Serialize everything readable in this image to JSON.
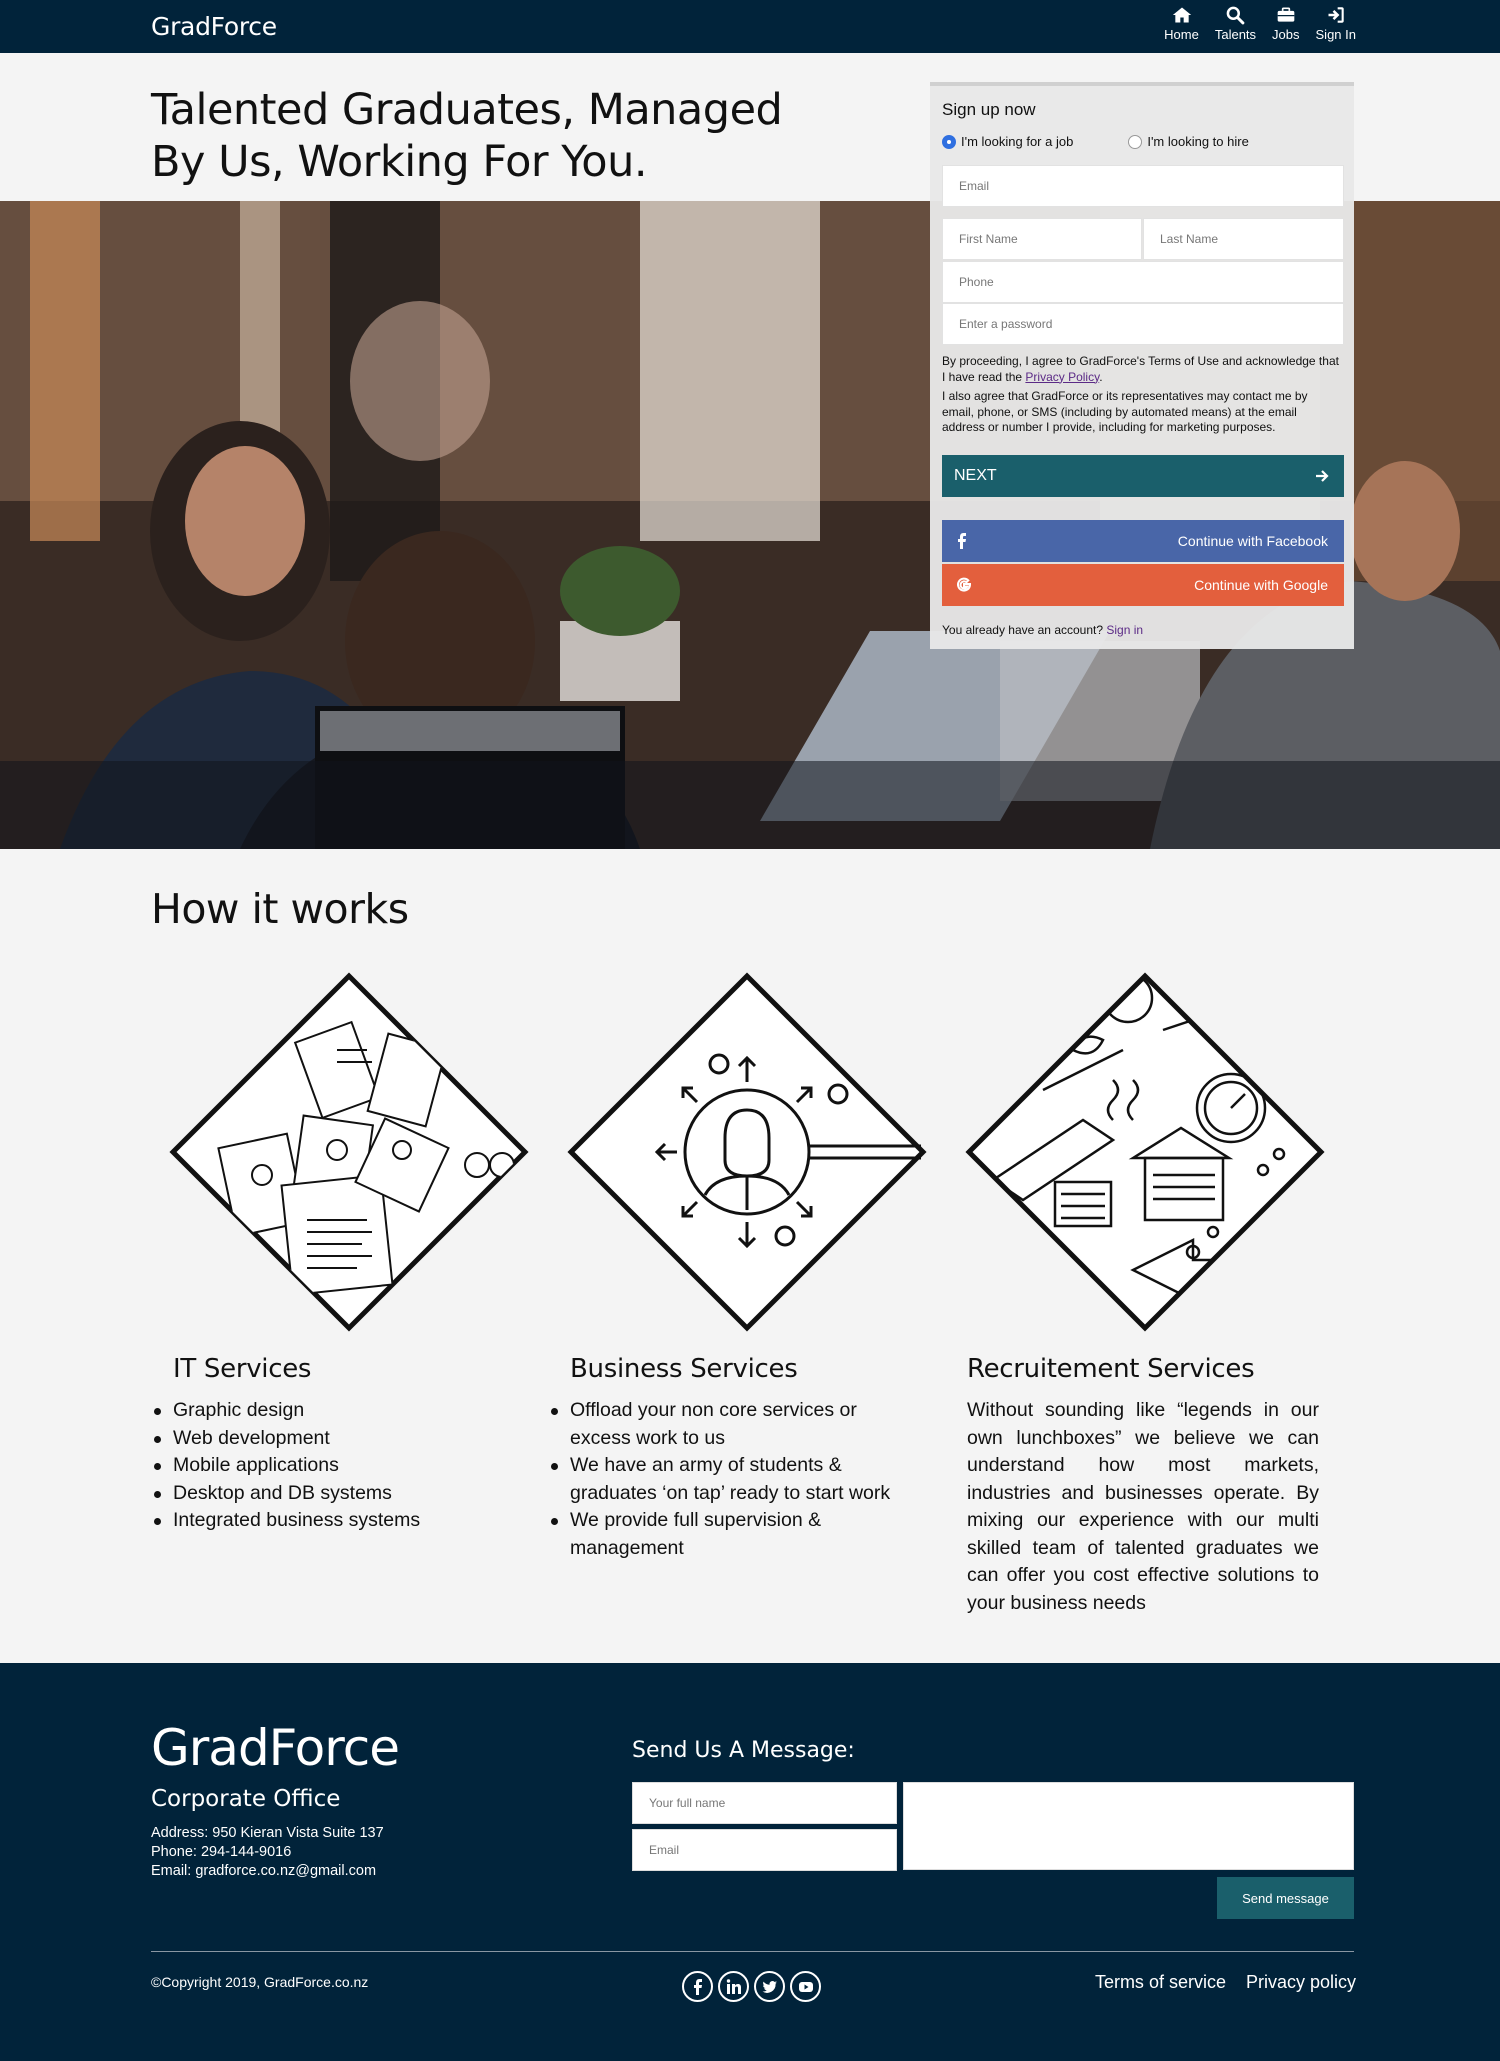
{
  "nav": {
    "brand": "GradForce",
    "items": [
      {
        "label": "Home",
        "icon": "home-icon"
      },
      {
        "label": "Talents",
        "icon": "search-icon"
      },
      {
        "label": "Jobs",
        "icon": "briefcase-icon"
      },
      {
        "label": "Sign In",
        "icon": "sign-in-icon"
      }
    ]
  },
  "hero": {
    "title": "Talented Graduates, Managed By Us, Working For You."
  },
  "signup": {
    "title": "Sign up now",
    "role_options": [
      {
        "label": "I'm looking for a job",
        "selected": true
      },
      {
        "label": "I'm looking to hire",
        "selected": false
      }
    ],
    "email_placeholder": "Email",
    "first_name_placeholder": "First Name",
    "last_name_placeholder": "Last Name",
    "phone_placeholder": "Phone",
    "password_placeholder": "Enter a password",
    "legal_1_prefix": "By proceeding, I agree to GradForce's Terms of Use and acknowledge that I have read the",
    "legal_1_link": "Privacy Policy",
    "legal_1_suffix": ".",
    "legal_2": "I also agree that GradForce or its representatives may contact me by email, phone, or SMS (including by automated means) at the email address or number I provide, including for marketing purposes.",
    "next_label": "NEXT",
    "facebook_label": "Continue with Facebook",
    "google_label": "Continue with Google",
    "already_text": "You already have an account?",
    "sign_in_link": "Sign in"
  },
  "how": {
    "title": "How it works",
    "services": [
      {
        "title": "IT Services",
        "items": [
          "Graphic design",
          "Web development",
          "Mobile applications",
          "Desktop and DB systems",
          "Integrated business systems"
        ]
      },
      {
        "title": "Business Services",
        "items": [
          "Offload your non core services or excess work to us",
          "We have an army of students & graduates ‘on tap’ ready to start work",
          "We provide full supervision & management"
        ]
      },
      {
        "title": "Recruitement Services",
        "paragraph": "Without sounding like “legends in our own lunchboxes” we believe we can understand how most markets, industries and businesses operate. By mixing our experience with our multi skilled team of talented graduates we can offer you cost effective solutions to your business needs"
      }
    ]
  },
  "footer": {
    "brand": "GradForce",
    "office_title": "Corporate Office",
    "address": "Address: 950 Kieran Vista Suite 137",
    "phone": "Phone: 294-144-9016",
    "email": "Email: gradforce.co.nz@gmail.com",
    "message_title": "Send Us A Message:",
    "name_placeholder": "Your full name",
    "email_placeholder": "Email",
    "send_label": "Send message",
    "copyright": "©Copyright 2019, GradForce.co.nz",
    "social": [
      "facebook-icon",
      "linkedin-icon",
      "twitter-icon",
      "youtube-icon"
    ],
    "links": [
      "Terms of service",
      "Privacy policy"
    ]
  },
  "colors": {
    "navy": "#01233a",
    "teal": "#1a5f6b",
    "facebook": "#4966a8",
    "google": "#e35f3d",
    "background": "#f4f4f4"
  }
}
